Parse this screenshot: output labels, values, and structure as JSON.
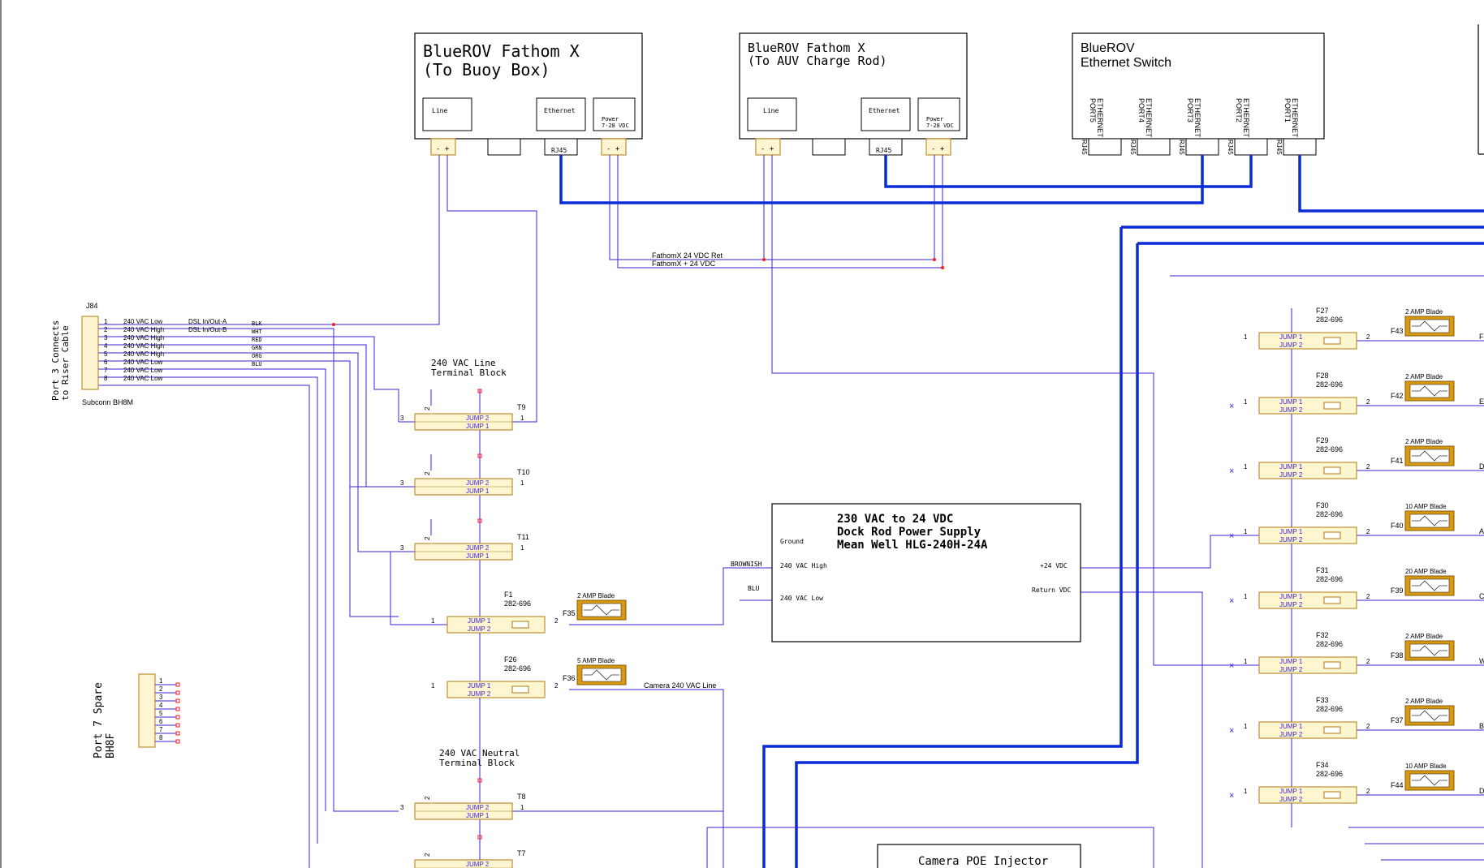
{
  "fathom_buoy": {
    "title1": "BlueROV Fathom X",
    "title2": "(To Buoy Box)",
    "line": "Line",
    "ethernet": "Ethernet",
    "power1": "Power",
    "power2": "7-28 VDC",
    "rj45": "RJ45"
  },
  "fathom_auv": {
    "title1": "BlueROV Fathom X",
    "title2": "(To AUV Charge Rod)",
    "line": "Line",
    "ethernet": "Ethernet",
    "power1": "Power",
    "power2": "7-28 VDC",
    "rj45": "RJ45"
  },
  "switch": {
    "title1": "BlueROV",
    "title2": "Ethernet Switch",
    "ports": [
      "ETHERNET PORT5",
      "ETHERNET PORT4",
      "ETHERNET PORT3",
      "ETHERNET PORT2",
      "ETHERNET PORT1"
    ],
    "rj45": "RJ45"
  },
  "nets": {
    "fathom_ret": "FathomX 24 VDC Ret",
    "fathom_pos": "FathomX + 24 VDC",
    "camera_line": "Camera 240 VAC Line"
  },
  "j84": {
    "ref": "J84",
    "side_label1": "Port 3 Connects",
    "side_label2": "to Riser Cable",
    "part": "Subconn BH8M",
    "pins": [
      {
        "num": "1",
        "name": "240 VAC Low",
        "sig": "DSL In/Out-A",
        "color": "BLK"
      },
      {
        "num": "2",
        "name": "240 VAC High",
        "sig": "DSL In/Out-B",
        "color": "WHT"
      },
      {
        "num": "3",
        "name": "240 VAC High",
        "sig": "",
        "color": "RED"
      },
      {
        "num": "4",
        "name": "240 VAC High",
        "sig": "",
        "color": "GRN"
      },
      {
        "num": "5",
        "name": "240 VAC High",
        "sig": "",
        "color": "ORG"
      },
      {
        "num": "6",
        "name": "240 VAC Low",
        "sig": "",
        "color": "BLU"
      },
      {
        "num": "7",
        "name": "240 VAC Low",
        "sig": "",
        "color": ""
      },
      {
        "num": "8",
        "name": "240 VAC Low",
        "sig": "",
        "color": ""
      }
    ]
  },
  "port7": {
    "label1": "Port 7 Spare",
    "label2": "BH8F",
    "pins": [
      "1",
      "2",
      "3",
      "4",
      "5",
      "6",
      "7",
      "8"
    ]
  },
  "tb_line_title1": "240 VAC Line",
  "tb_line_title2": "Terminal Block",
  "tb_neutral_title1": "240 VAC Neutral",
  "tb_neutral_title2": "Terminal Block",
  "jump1": "JUMP 1",
  "jump2": "JUMP 2",
  "terminals": [
    {
      "ref": "T9",
      "p1": "1",
      "p2": "2",
      "p3": "3"
    },
    {
      "ref": "T10",
      "p1": "1",
      "p2": "2",
      "p3": "3"
    },
    {
      "ref": "T11",
      "p1": "1",
      "p2": "2",
      "p3": "3"
    },
    {
      "ref": "T8",
      "p1": "1",
      "p2": "2",
      "p3": "3"
    },
    {
      "ref": "T7",
      "p1": "",
      "p2": "2",
      "p3": ""
    }
  ],
  "left_fuses": [
    {
      "ref": "F1",
      "part": "282-696",
      "fref": "F35",
      "blade": "2 AMP Blade",
      "p1": "1",
      "p2": "2"
    },
    {
      "ref": "F26",
      "part": "282-696",
      "fref": "F36",
      "blade": "5 AMP Blade",
      "p1": "1",
      "p2": "2"
    }
  ],
  "psu": {
    "title1": "230 VAC to 24 VDC",
    "title2": "Dock Rod Power Supply",
    "title3": "Mean Well HLG-240H-24A",
    "ground": "Ground",
    "high": "240 VAC High",
    "low": "240 VAC Low",
    "pos": "+24 VDC",
    "ret": "Return VDC",
    "brownish": "BROWNISH",
    "blu": "BLU"
  },
  "right_fuses": [
    {
      "ref": "F27",
      "part": "282-696",
      "fref": "F43",
      "blade": "2 AMP Blade",
      "out": "F"
    },
    {
      "ref": "F28",
      "part": "282-696",
      "fref": "F42",
      "blade": "2 AMP Blade",
      "out": "E"
    },
    {
      "ref": "F29",
      "part": "282-696",
      "fref": "F41",
      "blade": "2 AMP Blade",
      "out": "D"
    },
    {
      "ref": "F30",
      "part": "282-696",
      "fref": "F40",
      "blade": "10 AMP Blade",
      "out": "A"
    },
    {
      "ref": "F31",
      "part": "282-696",
      "fref": "F39",
      "blade": "20 AMP Blade",
      "out": "C"
    },
    {
      "ref": "F32",
      "part": "282-696",
      "fref": "F38",
      "blade": "2 AMP Blade",
      "out": "W"
    },
    {
      "ref": "F33",
      "part": "282-696",
      "fref": "F37",
      "blade": "2 AMP Blade",
      "out": "B"
    },
    {
      "ref": "F34",
      "part": "282-696",
      "fref": "F44",
      "blade": "10 AMP Blade",
      "out": "D"
    }
  ],
  "rfuse_pins": {
    "p1": "1",
    "p2": "2"
  },
  "camera_poe": "Camera POE Injector",
  "colors": {
    "wire": "#3b1fd6",
    "bus": "#0a2bd8",
    "part_fill": "#fdf6d0",
    "part_stroke": "#b07a10",
    "blade": "#d89a10",
    "dot": "#ff1a1a"
  }
}
